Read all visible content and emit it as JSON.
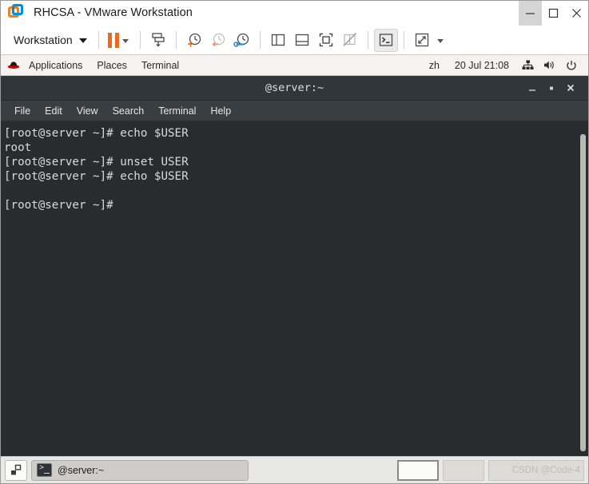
{
  "vmware": {
    "title": "RHCSA - VMware Workstation",
    "logo_icon": "vmware-logo-icon",
    "window_buttons": {
      "minimize": "minimize-icon",
      "maximize": "maximize-icon",
      "close": "close-icon"
    },
    "toolbar": {
      "menu_label": "Workstation",
      "menu_caret": "chevron-down-icon",
      "buttons": [
        {
          "name": "pause-vm-button",
          "icon": "pause-icon"
        },
        {
          "name": "pause-dropdown-button",
          "icon": "chevron-down-icon"
        },
        {
          "name": "suspend-guest-button",
          "icon": "suspend-download-icon"
        },
        {
          "name": "take-snapshot-button",
          "icon": "snapshot-add-clock-icon"
        },
        {
          "name": "revert-snapshot-button",
          "icon": "snapshot-revert-clock-icon"
        },
        {
          "name": "manage-snapshots-button",
          "icon": "snapshot-manager-clock-wrench-icon"
        },
        {
          "name": "show-library-button",
          "icon": "panel-left-icon"
        },
        {
          "name": "show-thumbnails-button",
          "icon": "panel-bottom-icon"
        },
        {
          "name": "full-screen-button",
          "icon": "fullscreen-brackets-icon"
        },
        {
          "name": "unity-mode-button",
          "icon": "unity-disabled-icon"
        },
        {
          "name": "console-view-button",
          "icon": "terminal-prompt-icon"
        },
        {
          "name": "stretch-guest-button",
          "icon": "expand-arrows-icon"
        },
        {
          "name": "stretch-dropdown-button",
          "icon": "chevron-down-icon"
        }
      ]
    },
    "colors": {
      "accent_orange": "#eb6a20",
      "accent_blue": "#0091da"
    }
  },
  "gnome_panel": {
    "logo_icon": "redhat-logo-icon",
    "menus": [
      "Applications",
      "Places",
      "Terminal"
    ],
    "input_source": "zh",
    "clock": "20 Jul 21:08",
    "tray": [
      {
        "name": "network-icon",
        "icon": "network-wired-icon"
      },
      {
        "name": "volume-icon",
        "icon": "speaker-volume-icon"
      },
      {
        "name": "power-icon",
        "icon": "power-button-icon"
      }
    ]
  },
  "terminal": {
    "title": "@server:~",
    "window_buttons": {
      "minimize": "minimize-icon",
      "maximize": "maximize-icon",
      "close": "close-icon"
    },
    "menus": [
      "File",
      "Edit",
      "View",
      "Search",
      "Terminal",
      "Help"
    ],
    "lines": [
      "[root@server ~]# echo $USER",
      "root",
      "[root@server ~]# unset USER",
      "[root@server ~]# echo $USER",
      "",
      "[root@server ~]#"
    ],
    "colors": {
      "background": "#282c2f",
      "foreground": "#d9dbd6"
    }
  },
  "taskbar": {
    "show_desktop_icon": "show-desktop-icon",
    "window_item": {
      "icon": "terminal-icon",
      "label": "@server:~"
    },
    "workspaces": [
      {
        "name": "workspace-1",
        "active": true
      },
      {
        "name": "workspace-2",
        "active": false
      }
    ],
    "watermark": "CSDN @Code-4"
  }
}
